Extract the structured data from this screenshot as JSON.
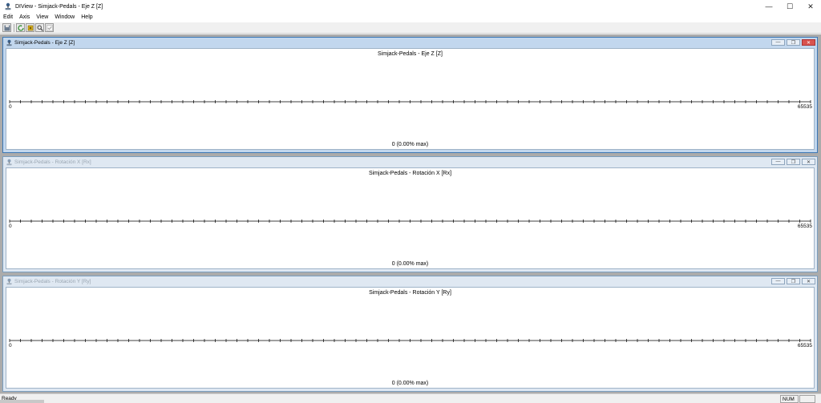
{
  "app": {
    "title": "DIView - Simjack-Pedals - Eje Z [Z]",
    "icon": "joystick-icon"
  },
  "caption_buttons": {
    "minimize": "—",
    "maximize": "☐",
    "close": "✕"
  },
  "menu": [
    {
      "label": "Edit"
    },
    {
      "label": "Axis"
    },
    {
      "label": "View"
    },
    {
      "label": "Window"
    },
    {
      "label": "Help"
    }
  ],
  "toolbar": [
    {
      "name": "save-icon"
    },
    {
      "name": "refresh-icon"
    },
    {
      "name": "device-icon"
    },
    {
      "name": "search-icon"
    },
    {
      "name": "check-icon"
    }
  ],
  "child_windows": [
    {
      "title": "Simjack-Pedals - Eje Z [Z]",
      "plot_title": "Simjack-Pedals - Eje Z [Z]",
      "min_label": "0",
      "max_label": "65535",
      "value_text": "0 (0.00% max)",
      "active": true
    },
    {
      "title": "Simjack-Pedals - Rotación X [Rx]",
      "plot_title": "Simjack-Pedals - Rotación X [Rx]",
      "min_label": "0",
      "max_label": "65535",
      "value_text": "0 (0.00% max)",
      "active": false
    },
    {
      "title": "Simjack-Pedals - Rotación Y [Ry]",
      "plot_title": "Simjack-Pedals - Rotación Y [Ry]",
      "min_label": "0",
      "max_label": "65535",
      "value_text": "0 (0.00% max)",
      "active": false
    }
  ],
  "status": {
    "text": "Ready",
    "num": "NUM"
  },
  "colors": {
    "active_border": "#3b77b5",
    "inactive_border": "#7a9ebf",
    "mdi_background": "#ababab"
  }
}
